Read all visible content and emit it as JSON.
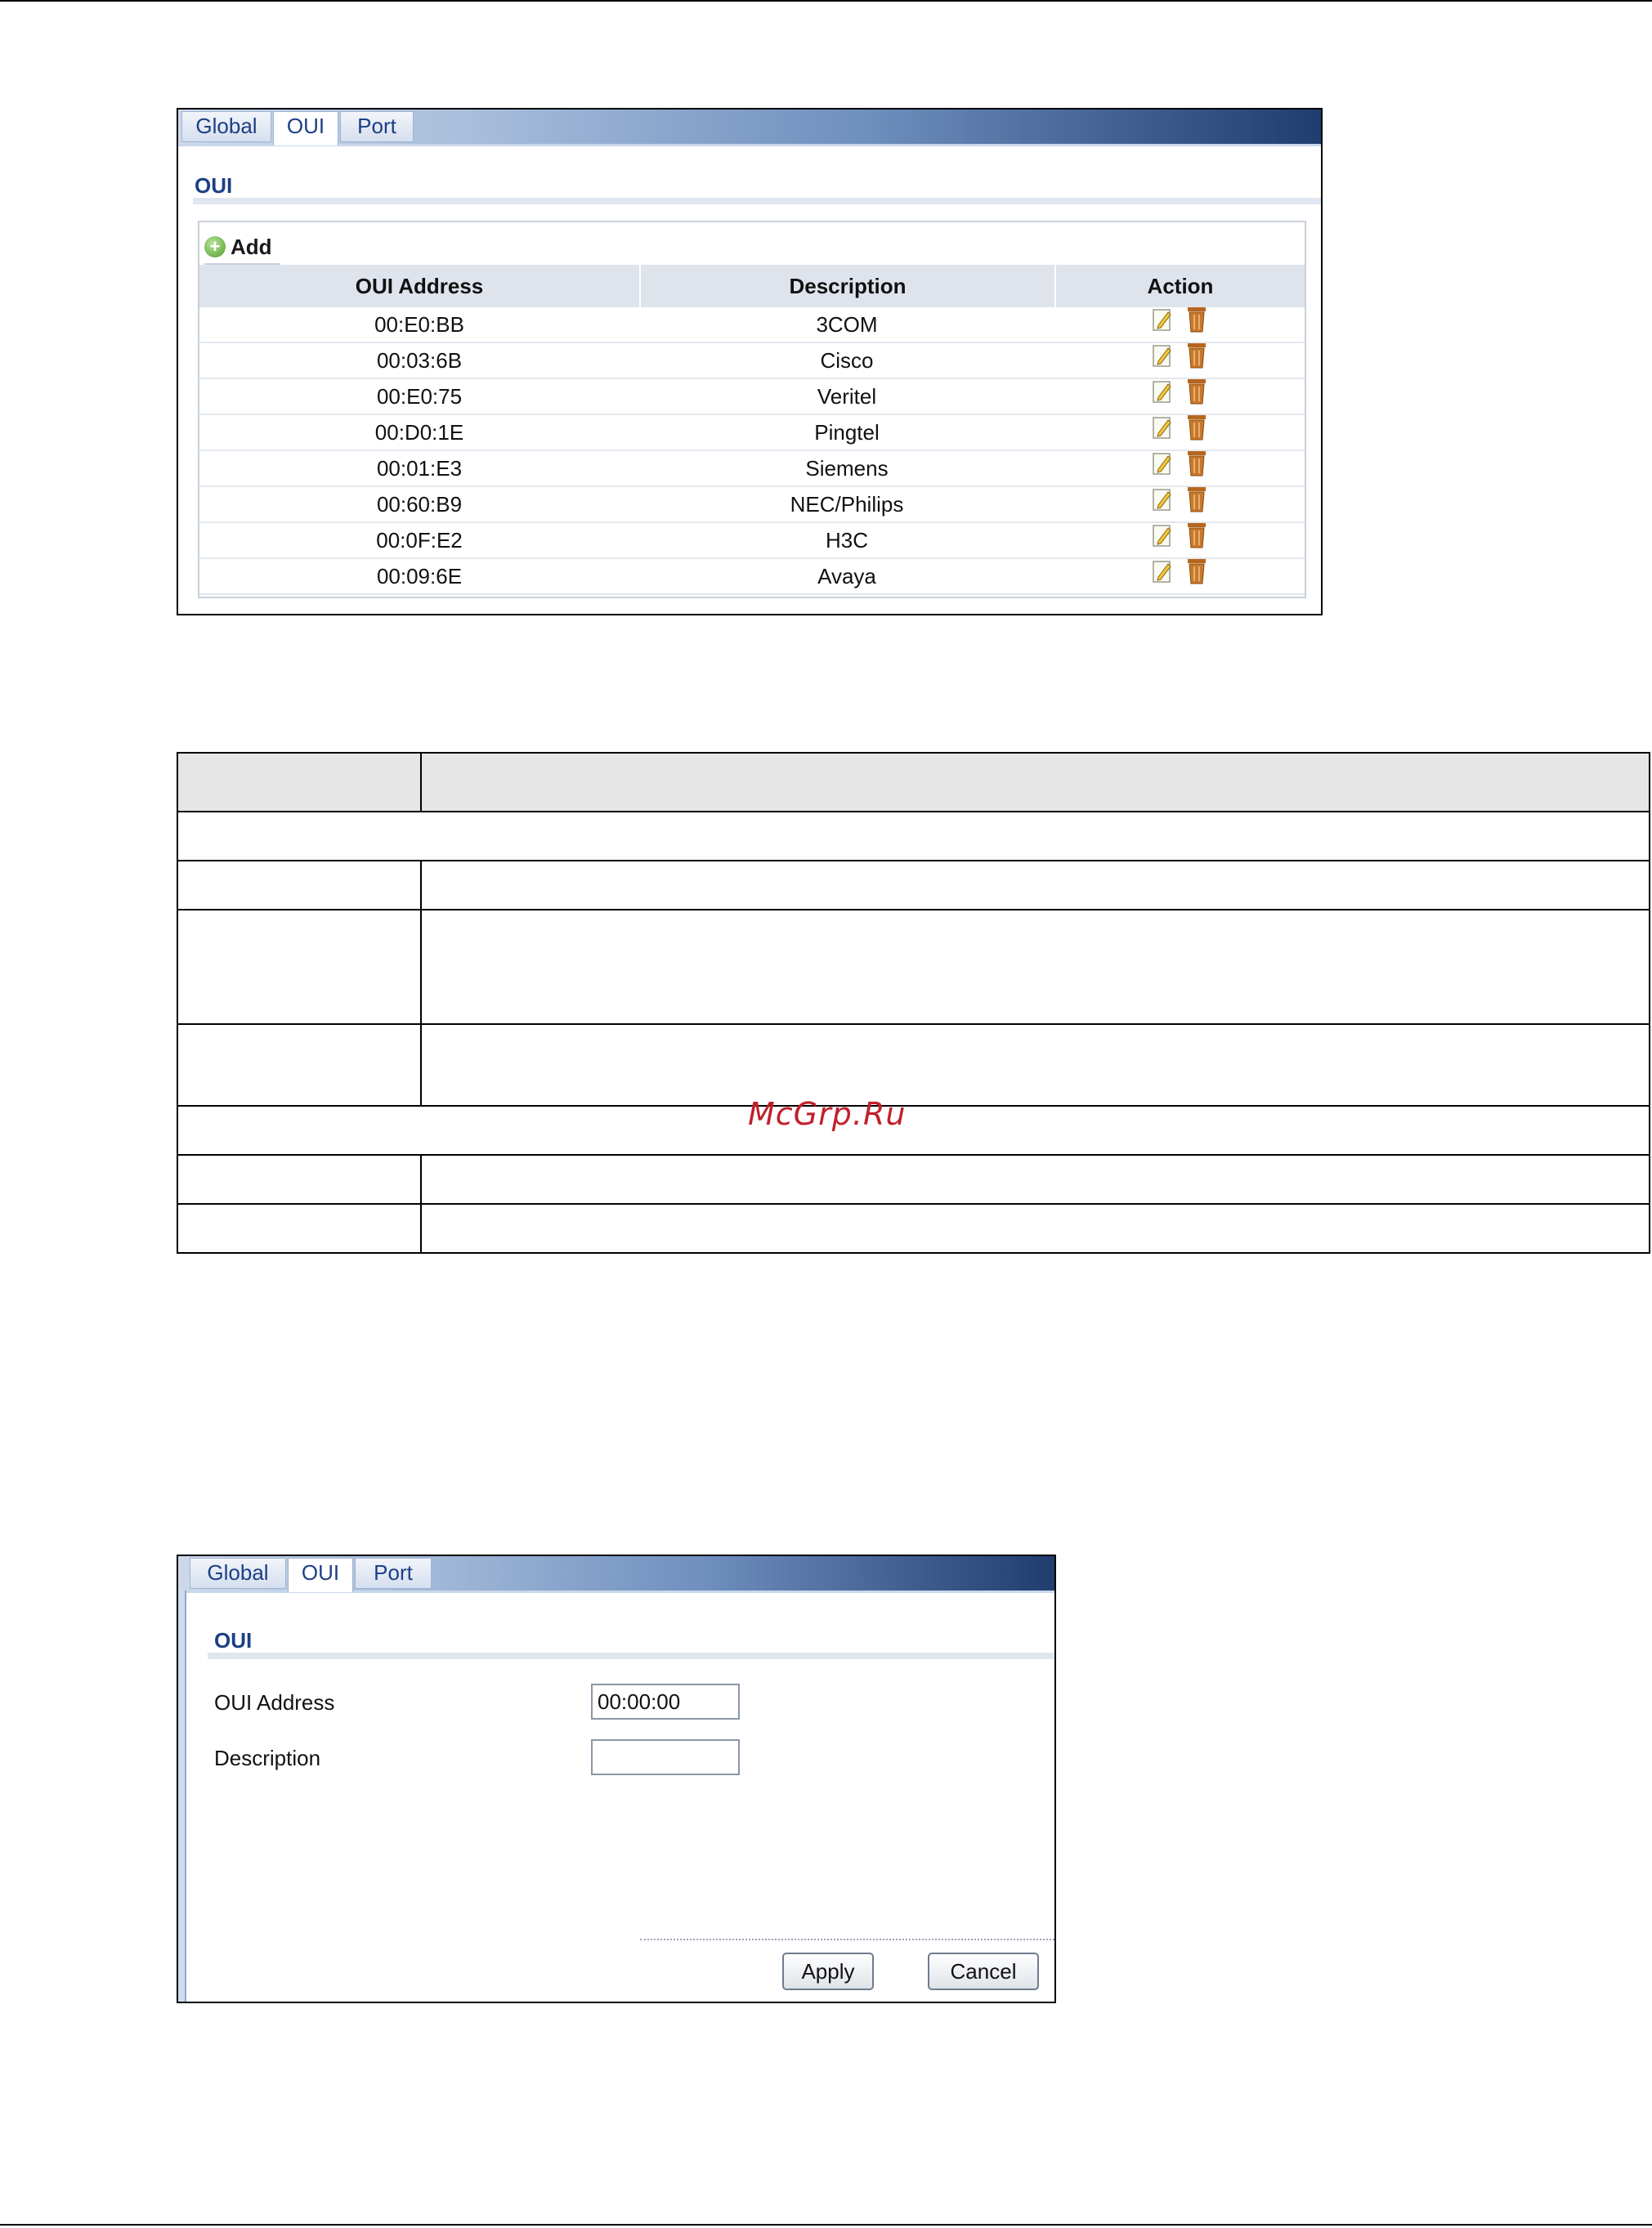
{
  "screen1": {
    "tabs": [
      {
        "label": "Global",
        "active": false
      },
      {
        "label": "OUI",
        "active": true
      },
      {
        "label": "Port",
        "active": false
      }
    ],
    "section_title": "OUI",
    "add_label": "Add",
    "columns": [
      "OUI Address",
      "Description",
      "Action"
    ],
    "rows": [
      {
        "address": "00:E0:BB",
        "description": "3COM"
      },
      {
        "address": "00:03:6B",
        "description": "Cisco"
      },
      {
        "address": "00:E0:75",
        "description": "Veritel"
      },
      {
        "address": "00:D0:1E",
        "description": "Pingtel"
      },
      {
        "address": "00:01:E3",
        "description": "Siemens"
      },
      {
        "address": "00:60:B9",
        "description": "NEC/Philips"
      },
      {
        "address": "00:0F:E2",
        "description": "H3C"
      },
      {
        "address": "00:09:6E",
        "description": "Avaya"
      }
    ]
  },
  "watermark": "McGrp.Ru",
  "screen2": {
    "tabs": [
      {
        "label": "Global",
        "active": false
      },
      {
        "label": "OUI",
        "active": true
      },
      {
        "label": "Port",
        "active": false
      }
    ],
    "section_title": "OUI",
    "fields": {
      "oui_address_label": "OUI Address",
      "oui_address_value": "00:00:00",
      "description_label": "Description",
      "description_value": ""
    },
    "apply_label": "Apply",
    "cancel_label": "Cancel"
  },
  "colors": {
    "tab_text": "#1c3f85",
    "tabbar_dark": "#1f3d6e",
    "watermark": "#c0202c"
  }
}
